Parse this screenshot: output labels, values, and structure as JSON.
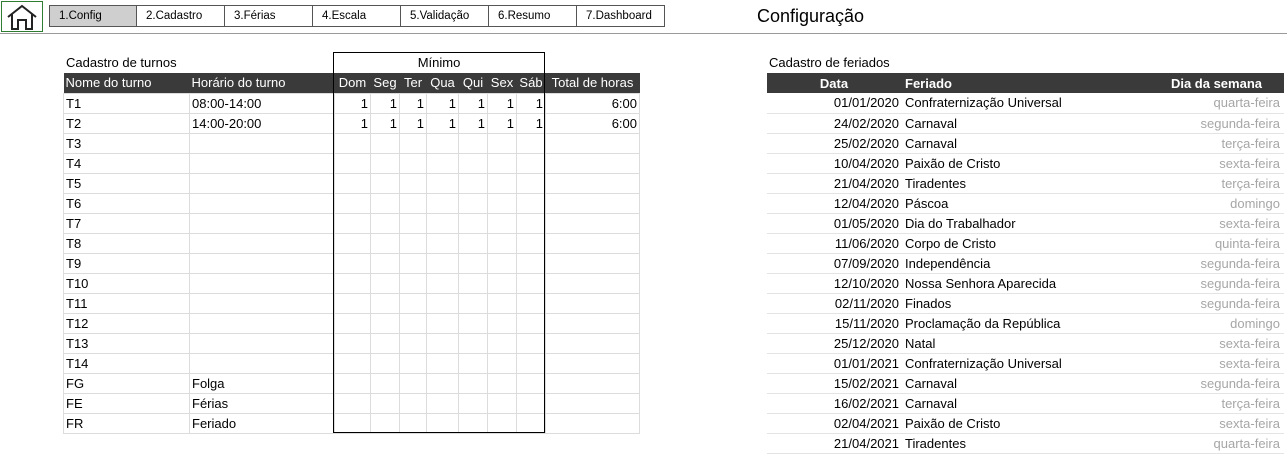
{
  "nav": {
    "tabs": [
      "1.Config",
      "2.Cadastro",
      "3.Férias",
      "4.Escala",
      "5.Validação",
      "6.Resumo",
      "7.Dashboard"
    ],
    "active_index": 0
  },
  "page_title": "Configuração",
  "shifts": {
    "title": "Cadastro de turnos",
    "minimo_label": "Mínimo",
    "headers": {
      "name": "Nome do turno",
      "schedule": "Horário do turno",
      "days": [
        "Dom",
        "Seg",
        "Ter",
        "Qua",
        "Qui",
        "Sex",
        "Sáb"
      ],
      "total": "Total de horas"
    },
    "rows": [
      {
        "name": "T1",
        "schedule": "08:00-14:00",
        "days": [
          "1",
          "1",
          "1",
          "1",
          "1",
          "1",
          "1"
        ],
        "total": "6:00"
      },
      {
        "name": "T2",
        "schedule": "14:00-20:00",
        "days": [
          "1",
          "1",
          "1",
          "1",
          "1",
          "1",
          "1"
        ],
        "total": "6:00"
      },
      {
        "name": "T3",
        "schedule": "",
        "days": [
          "",
          "",
          "",
          "",
          "",
          "",
          ""
        ],
        "total": ""
      },
      {
        "name": "T4",
        "schedule": "",
        "days": [
          "",
          "",
          "",
          "",
          "",
          "",
          ""
        ],
        "total": ""
      },
      {
        "name": "T5",
        "schedule": "",
        "days": [
          "",
          "",
          "",
          "",
          "",
          "",
          ""
        ],
        "total": ""
      },
      {
        "name": "T6",
        "schedule": "",
        "days": [
          "",
          "",
          "",
          "",
          "",
          "",
          ""
        ],
        "total": ""
      },
      {
        "name": "T7",
        "schedule": "",
        "days": [
          "",
          "",
          "",
          "",
          "",
          "",
          ""
        ],
        "total": ""
      },
      {
        "name": "T8",
        "schedule": "",
        "days": [
          "",
          "",
          "",
          "",
          "",
          "",
          ""
        ],
        "total": ""
      },
      {
        "name": "T9",
        "schedule": "",
        "days": [
          "",
          "",
          "",
          "",
          "",
          "",
          ""
        ],
        "total": ""
      },
      {
        "name": "T10",
        "schedule": "",
        "days": [
          "",
          "",
          "",
          "",
          "",
          "",
          ""
        ],
        "total": ""
      },
      {
        "name": "T11",
        "schedule": "",
        "days": [
          "",
          "",
          "",
          "",
          "",
          "",
          ""
        ],
        "total": ""
      },
      {
        "name": "T12",
        "schedule": "",
        "days": [
          "",
          "",
          "",
          "",
          "",
          "",
          ""
        ],
        "total": ""
      },
      {
        "name": "T13",
        "schedule": "",
        "days": [
          "",
          "",
          "",
          "",
          "",
          "",
          ""
        ],
        "total": ""
      },
      {
        "name": "T14",
        "schedule": "",
        "days": [
          "",
          "",
          "",
          "",
          "",
          "",
          ""
        ],
        "total": ""
      },
      {
        "name": "FG",
        "schedule": "Folga",
        "days": [
          "",
          "",
          "",
          "",
          "",
          "",
          ""
        ],
        "total": ""
      },
      {
        "name": "FE",
        "schedule": "Férias",
        "days": [
          "",
          "",
          "",
          "",
          "",
          "",
          ""
        ],
        "total": ""
      },
      {
        "name": "FR",
        "schedule": "Feriado",
        "days": [
          "",
          "",
          "",
          "",
          "",
          "",
          ""
        ],
        "total": ""
      }
    ]
  },
  "holidays": {
    "title": "Cadastro de feriados",
    "headers": {
      "date": "Data",
      "name": "Feriado",
      "weekday": "Dia da semana"
    },
    "rows": [
      {
        "date": "01/01/2020",
        "name": "Confraternização Universal",
        "weekday": "quarta-feira"
      },
      {
        "date": "24/02/2020",
        "name": "Carnaval",
        "weekday": "segunda-feira"
      },
      {
        "date": "25/02/2020",
        "name": "Carnaval",
        "weekday": "terça-feira"
      },
      {
        "date": "10/04/2020",
        "name": "Paixão de Cristo",
        "weekday": "sexta-feira"
      },
      {
        "date": "21/04/2020",
        "name": "Tiradentes",
        "weekday": "terça-feira"
      },
      {
        "date": "12/04/2020",
        "name": "Páscoa",
        "weekday": "domingo"
      },
      {
        "date": "01/05/2020",
        "name": "Dia do Trabalhador",
        "weekday": "sexta-feira"
      },
      {
        "date": "11/06/2020",
        "name": "Corpo de Cristo",
        "weekday": "quinta-feira"
      },
      {
        "date": "07/09/2020",
        "name": "Independência",
        "weekday": "segunda-feira"
      },
      {
        "date": "12/10/2020",
        "name": "Nossa Senhora Aparecida",
        "weekday": "segunda-feira"
      },
      {
        "date": "02/11/2020",
        "name": "Finados",
        "weekday": "segunda-feira"
      },
      {
        "date": "15/11/2020",
        "name": "Proclamação da República",
        "weekday": "domingo"
      },
      {
        "date": "25/12/2020",
        "name": "Natal",
        "weekday": "sexta-feira"
      },
      {
        "date": "01/01/2021",
        "name": "Confraternização Universal",
        "weekday": "sexta-feira"
      },
      {
        "date": "15/02/2021",
        "name": "Carnaval",
        "weekday": "segunda-feira"
      },
      {
        "date": "16/02/2021",
        "name": "Carnaval",
        "weekday": "terça-feira"
      },
      {
        "date": "02/04/2021",
        "name": "Paixão de Cristo",
        "weekday": "sexta-feira"
      },
      {
        "date": "21/04/2021",
        "name": "Tiradentes",
        "weekday": "quarta-feira"
      }
    ]
  }
}
